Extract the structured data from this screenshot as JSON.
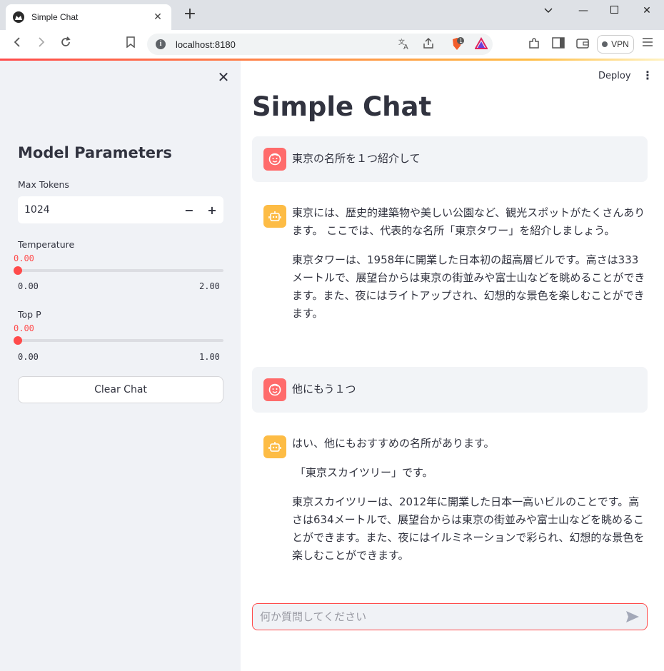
{
  "browser": {
    "tab_title": "Simple Chat",
    "url": "localhost:8180",
    "vpn_label": "VPN",
    "brave_badge": "1"
  },
  "app": {
    "deploy_label": "Deploy",
    "title": "Simple Chat"
  },
  "sidebar": {
    "title": "Model Parameters",
    "max_tokens": {
      "label": "Max Tokens",
      "value": "1024"
    },
    "temperature": {
      "label": "Temperature",
      "value": "0.00",
      "min": "0.00",
      "max": "2.00",
      "fraction": 0
    },
    "top_p": {
      "label": "Top P",
      "value": "0.00",
      "min": "0.00",
      "max": "1.00",
      "fraction": 0
    },
    "clear_label": "Clear Chat"
  },
  "messages": [
    {
      "role": "user",
      "paragraphs": [
        "東京の名所を１つ紹介して"
      ]
    },
    {
      "role": "assistant",
      "paragraphs": [
        "東京には、歴史的建築物や美しい公園など、観光スポットがたくさんあります。 ここでは、代表的な名所「東京タワー」を紹介しましょう。",
        "東京タワーは、1958年に開業した日本初の超高層ビルです。高さは333メートルで、展望台からは東京の街並みや富士山などを眺めることができます。また、夜にはライトアップされ、幻想的な景色を楽しむことができます。"
      ]
    },
    {
      "role": "user",
      "paragraphs": [
        "他にもう１つ"
      ]
    },
    {
      "role": "assistant",
      "paragraphs": [
        "はい、他にもおすすめの名所があります。",
        "「東京スカイツリー」です。",
        "東京スカイツリーは、2012年に開業した日本一高いビルのことです。高さは634メートルで、展望台からは東京の街並みや富士山などを眺めることができます。また、夜にはイルミネーションで彩られ、幻想的な景色を楽しむことができます。"
      ]
    }
  ],
  "chat_input": {
    "placeholder": "何か質問してください"
  },
  "colors": {
    "accent": "#ff4b4b",
    "sidebar_bg": "#f0f2f6",
    "user_avatar": "#ff6b6b",
    "bot_avatar": "#fdbc45"
  }
}
